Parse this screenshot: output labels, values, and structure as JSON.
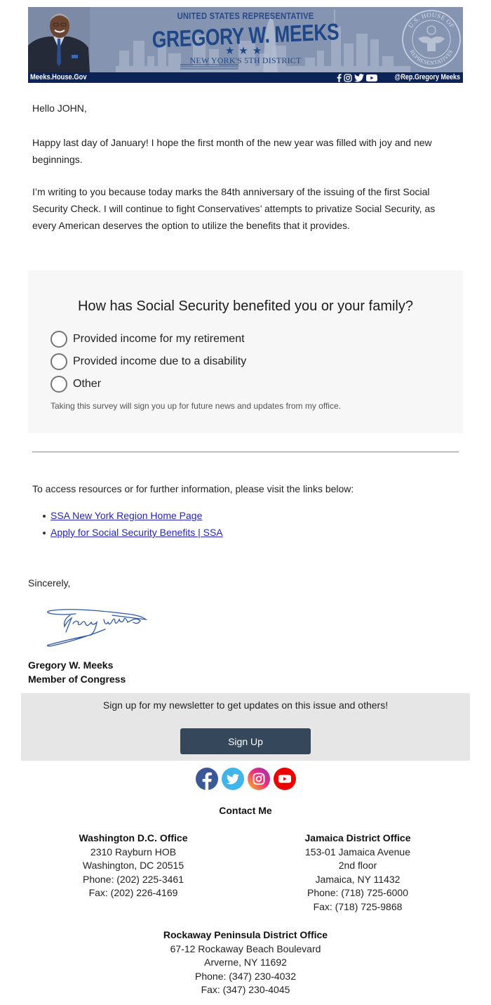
{
  "banner": {
    "title_line": "UNITED STATES REPRESENTATIVE",
    "name": "GREGORY W. MEEKS",
    "stars": "★★★",
    "district": "NEW YORK'S 5TH DISTRICT",
    "seal_text_top": "U.S. HOUSE OF",
    "seal_text_bottom": "REPRESENTATIVES",
    "website": "Meeks.House.Gov",
    "social_icons": [
      "facebook-icon",
      "instagram-icon",
      "twitter-icon",
      "youtube-icon"
    ],
    "handle": "@Rep.Gregory Meeks",
    "colors": {
      "background": "#8595b1",
      "bar": "#0c2358",
      "text": "#1f4788"
    }
  },
  "letter": {
    "greeting": "Hello JOHN,",
    "paragraphs": [
      "Happy last day of January! I hope the first month of the new year was filled with joy and new beginnings.",
      "I’m writing to you because today marks the 84th anniversary of the issuing of the first Social Security Check. I will continue to fight Conservatives’ attempts to privatize Social Security, as every American deserves the option to utilize the benefits that it provides."
    ]
  },
  "survey": {
    "question": "How has Social Security benefited you or your family?",
    "options": [
      {
        "label": "Provided income for my retirement",
        "selected": false
      },
      {
        "label": "Provided income due to a disability",
        "selected": false
      },
      {
        "label": "Other",
        "selected": false
      }
    ],
    "note": "Taking this survey will sign you up for future news and updates from my office."
  },
  "resources": {
    "intro": "To access resources or for further information, please visit the links below:",
    "links": [
      {
        "label": "SSA New York Region Home Page"
      },
      {
        "label": "Apply for Social Security Benefits | SSA"
      }
    ]
  },
  "closing": {
    "sincerely": "Sincerely,",
    "signature_text": "Gregory W Meeks",
    "name": "Gregory W. Meeks",
    "title": "Member of Congress"
  },
  "newsletter": {
    "message": "Sign up for my newsletter to get updates on this issue and others!",
    "button_label": "Sign Up",
    "button_color": "#34475b"
  },
  "footer_socials": [
    {
      "name": "facebook",
      "color": "#3b5998"
    },
    {
      "name": "twitter",
      "color": "#3fb5ea"
    },
    {
      "name": "instagram",
      "color": "#e1306c"
    },
    {
      "name": "youtube",
      "color": "#ee0000"
    }
  ],
  "contact": {
    "title": "Contact Me",
    "offices": [
      {
        "name": "Washington D.C. Office",
        "lines": [
          "2310 Rayburn HOB",
          "Washington, DC 20515",
          "Phone: (202) 225-3461",
          "Fax: (202) 226-4169"
        ]
      },
      {
        "name": "Jamaica District Office",
        "lines": [
          "153-01 Jamaica Avenue",
          "2nd floor",
          "Jamaica, NY 11432",
          "Phone: (718) 725-6000",
          "Fax: (718) 725-9868"
        ]
      },
      {
        "name": "Rockaway Peninsula District Office",
        "lines": [
          "67-12 Rockaway Beach Boulevard",
          "Arverne, NY 11692",
          "Phone: (347) 230-4032",
          "Fax: (347) 230-4045"
        ]
      }
    ]
  }
}
